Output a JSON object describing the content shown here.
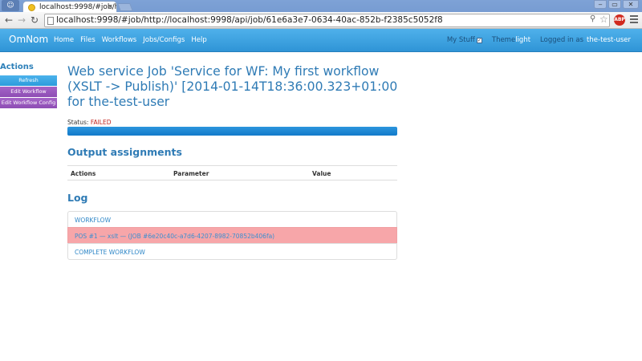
{
  "browser": {
    "tab_title": "localhost:9998/#job/h",
    "tab_close": "×",
    "url": "localhost:9998/#job/http://localhost:9998/api/job/61e6a3e7-0634-40ac-852b-f2385c5052f8",
    "extension_label": "ABP",
    "window_buttons": [
      "‒",
      "▭",
      "✕"
    ]
  },
  "navbar": {
    "brand": "OmNom",
    "links": [
      "Home",
      "Files",
      "Workflows",
      "Jobs/Configs",
      "Help"
    ],
    "my_stuff_label": "My Stuff",
    "my_stuff_checked": "✓",
    "theme_label": "Theme",
    "theme_value": "light",
    "logged_in_label": "Logged in as",
    "user": "the-test-user"
  },
  "sidebar": {
    "title": "Actions",
    "buttons": [
      "Refresh",
      "Edit Workflow",
      "Edit Workflow Config"
    ]
  },
  "main": {
    "title": "Web service Job 'Service for WF: My first workflow (XSLT -> Publish)' [2014-01-14T18:36:00.323+01:00 for the-test-user",
    "status_label": "Status:",
    "status_value": "FAILED",
    "progress_percent": 100,
    "output_heading": "Output assignments",
    "output_columns": [
      "Actions",
      "Parameter",
      "Value"
    ],
    "log_heading": "Log",
    "log_items": [
      "WORKFLOW",
      "POS #1 — xslt — (JOB #6e20c40c-a7d6-4207-8982-70852b406fa)",
      "COMPLETE WORKFLOW"
    ]
  },
  "colors": {
    "navbar": "#3aa0e0",
    "heading": "#2f7bb5",
    "status_failed": "#c0221c",
    "log_error_bg": "#f7a6a9",
    "sidebar_purple": "#9b59c2"
  }
}
